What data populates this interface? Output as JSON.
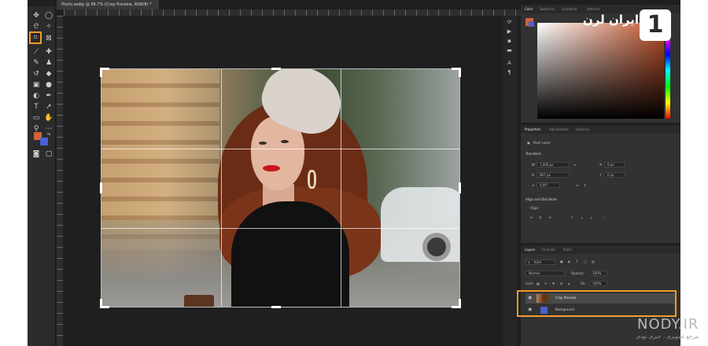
{
  "document": {
    "tab_title": "Photo.webp @ 66.7% (Crop Preview, RGB/8) *"
  },
  "toolbar": {
    "active_tool": "crop-tool",
    "foreground_color": "#d4623a",
    "background_color": "#4a5fd6"
  },
  "color_panel": {
    "tabs": [
      "Color",
      "Swatches",
      "Gradients",
      "Patterns"
    ],
    "active_tab": "Color"
  },
  "properties_panel": {
    "tabs": [
      "Properties",
      "Adjustments",
      "Libraries"
    ],
    "active_tab": "Properties",
    "layer_type": "Pixel Layer",
    "transform_label": "Transform",
    "w_label": "W",
    "w_value": "1,000 px",
    "h_label": "H",
    "h_value": "667 px",
    "x_label": "X",
    "x_value": "0 px",
    "y_label": "Y",
    "y_value": "0 px",
    "angle_value": "0.00°",
    "align_label": "Align and Distribute",
    "align_sub": "Align:"
  },
  "layers_panel": {
    "tabs": [
      "Layers",
      "Channels",
      "Paths"
    ],
    "active_tab": "Layers",
    "filter_placeholder": "Kind",
    "blend_mode": "Normal",
    "opacity_label": "Opacity:",
    "opacity_value": "100%",
    "lock_label": "Lock:",
    "fill_label": "Fill:",
    "fill_value": "100%",
    "layers": [
      {
        "name": "Crop Preview",
        "selected": true
      },
      {
        "name": "Background",
        "selected": false
      }
    ]
  },
  "watermark": {
    "logo_number": "1",
    "logo_text": "ایران لرن",
    "site": "NODY.IR",
    "site_sub": "مرجع تصویری ، خبری نودی"
  }
}
